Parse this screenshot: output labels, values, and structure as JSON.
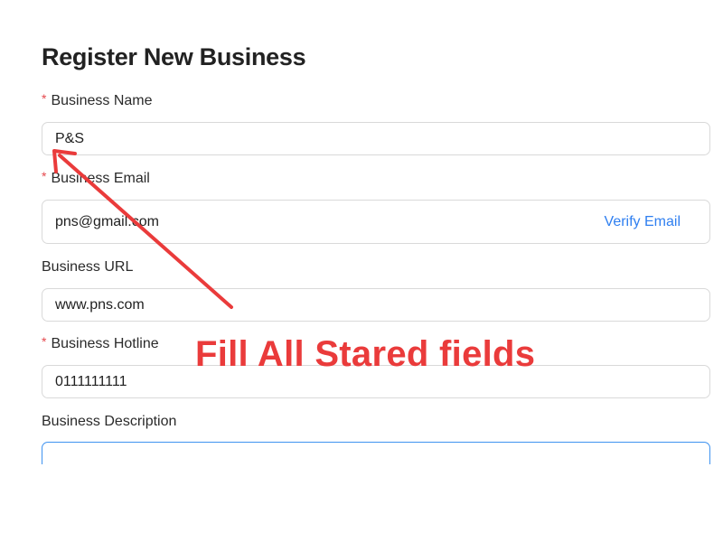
{
  "form": {
    "title": "Register New Business",
    "required_marker": "*",
    "fields": {
      "business_name": {
        "label": "Business Name",
        "required": true,
        "value": "P&S"
      },
      "business_email": {
        "label": "Business Email",
        "required": true,
        "value": "pns@gmail.com",
        "action_label": "Verify Email"
      },
      "business_url": {
        "label": "Business URL",
        "required": false,
        "value": "www.pns.com"
      },
      "business_hotline": {
        "label": "Business Hotline",
        "required": true,
        "value": "0111111111"
      },
      "business_description": {
        "label": "Business Description",
        "required": false,
        "value": ""
      }
    }
  },
  "annotation": {
    "text": "Fill All Stared fields",
    "color": "#ea3b3b"
  },
  "colors": {
    "required": "#e5484d",
    "link": "#2f7ff0",
    "focus_border": "#3f93f0"
  }
}
